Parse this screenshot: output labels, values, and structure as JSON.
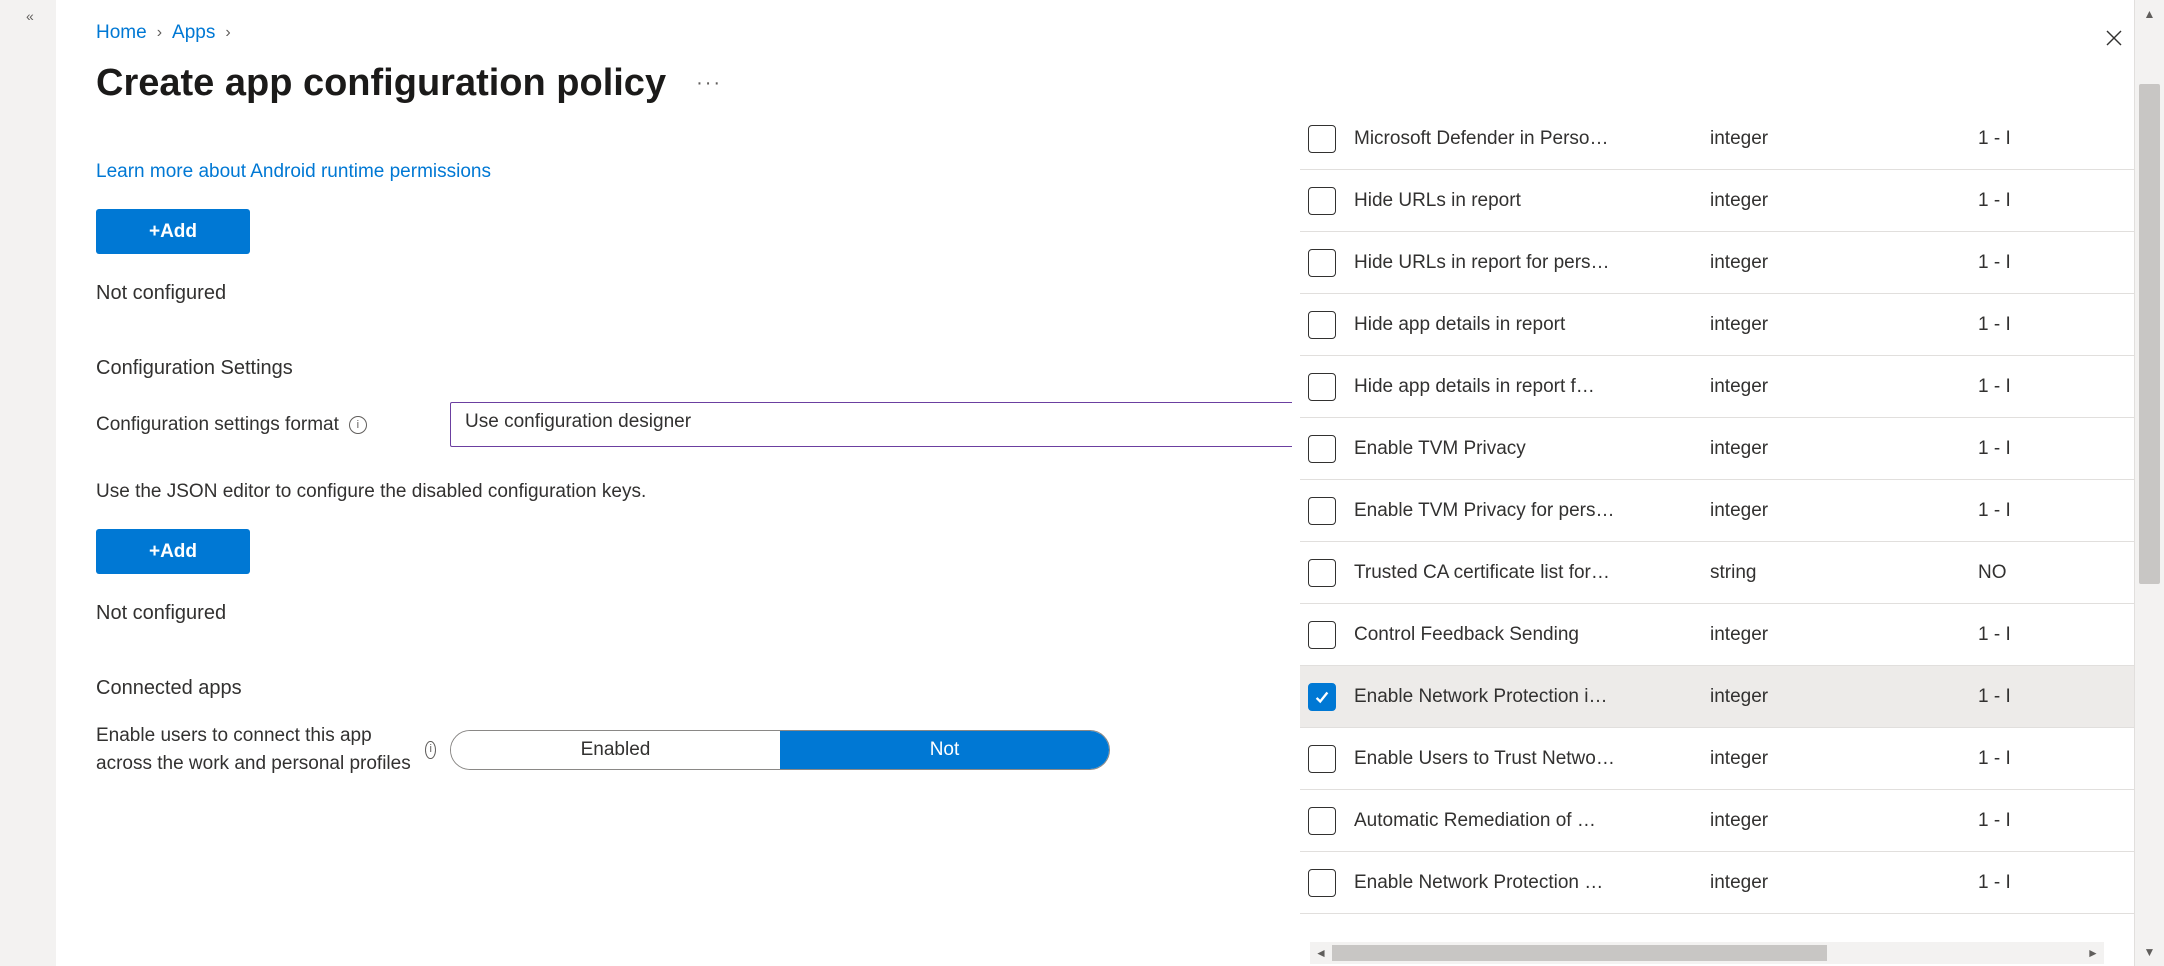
{
  "breadcrumb": {
    "home": "Home",
    "apps": "Apps"
  },
  "title": "Create app configuration policy",
  "link_permissions": "Learn more about Android runtime permissions",
  "add_label": "+Add",
  "not_configured": "Not configured",
  "section_config_settings": "Configuration Settings",
  "config_format_label": "Configuration settings format",
  "config_format_value": "Use configuration designer",
  "helper_json": "Use the JSON editor to configure the disabled configuration keys.",
  "section_connected": "Connected apps",
  "connected_desc": "Enable users to connect this app across the work and personal profiles",
  "toggle_enabled": "Enabled",
  "toggle_not": "Not",
  "flyout": {
    "rows": [
      {
        "checked": false,
        "name": "Microsoft Defender in Perso…",
        "type": "integer",
        "val": "1 - I"
      },
      {
        "checked": false,
        "name": "Hide URLs in report",
        "type": "integer",
        "val": "1 - I"
      },
      {
        "checked": false,
        "name": "Hide URLs in report for pers…",
        "type": "integer",
        "val": "1 - I"
      },
      {
        "checked": false,
        "name": "Hide app details in report",
        "type": "integer",
        "val": "1 - I"
      },
      {
        "checked": false,
        "name": "Hide app details in report f…",
        "type": "integer",
        "val": "1 - I"
      },
      {
        "checked": false,
        "name": "Enable TVM Privacy",
        "type": "integer",
        "val": "1 - I"
      },
      {
        "checked": false,
        "name": "Enable TVM Privacy for pers…",
        "type": "integer",
        "val": "1 - I"
      },
      {
        "checked": false,
        "name": "Trusted CA certificate list for…",
        "type": "string",
        "val": "NO"
      },
      {
        "checked": false,
        "name": "Control Feedback Sending",
        "type": "integer",
        "val": "1 - I"
      },
      {
        "checked": true,
        "name": "Enable Network Protection i…",
        "type": "integer",
        "val": "1 - I"
      },
      {
        "checked": false,
        "name": "Enable Users to Trust Netwo…",
        "type": "integer",
        "val": "1 - I"
      },
      {
        "checked": false,
        "name": "Automatic Remediation of …",
        "type": "integer",
        "val": "1 - I"
      },
      {
        "checked": false,
        "name": "Enable Network Protection …",
        "type": "integer",
        "val": "1 - I"
      }
    ]
  }
}
